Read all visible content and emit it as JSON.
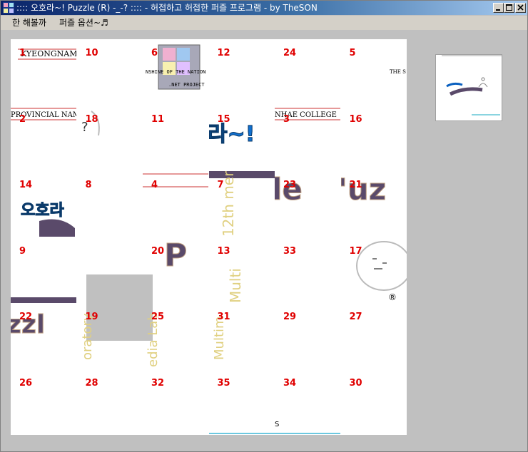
{
  "window": {
    "title": ":::: 오호라~! Puzzle (R) -_-?  :::: - 허접하고 허접한 퍼즐 프로그램 - by TheSON"
  },
  "menu": {
    "items": [
      "한 해볼까",
      "퍼즐 옵션~♬"
    ]
  },
  "board": {
    "grid": 6,
    "empty_number": null,
    "tiles": [
      [
        1,
        10,
        6,
        12,
        24,
        5
      ],
      [
        2,
        18,
        11,
        15,
        3,
        16
      ],
      [
        14,
        8,
        4,
        7,
        23,
        21
      ],
      [
        9,
        0,
        20,
        13,
        33,
        17
      ],
      [
        22,
        19,
        25,
        31,
        29,
        27
      ],
      [
        26,
        28,
        32,
        35,
        34,
        30
      ]
    ]
  },
  "image_text": {
    "line1": "KYEONGNAM",
    "line2": "PROVINCIAL NAM",
    "line3": "NSHINE OF THE NATION",
    "line4": ".NET PROJECT",
    "line5": "THE S",
    "line6": "NHAE COLLEGE",
    "line7": "MultiMedia Laboratory",
    "line8": "12th member",
    "line9": "오호라~!",
    "line10": "Puzzle",
    "registered": "®",
    "question": "?"
  },
  "colors": {
    "title_from": "#0a246a",
    "title_to": "#a6caf0",
    "tile_number": "#e00000",
    "board_bg": "#ffffff",
    "empty_tile": "#c0c0c0"
  }
}
